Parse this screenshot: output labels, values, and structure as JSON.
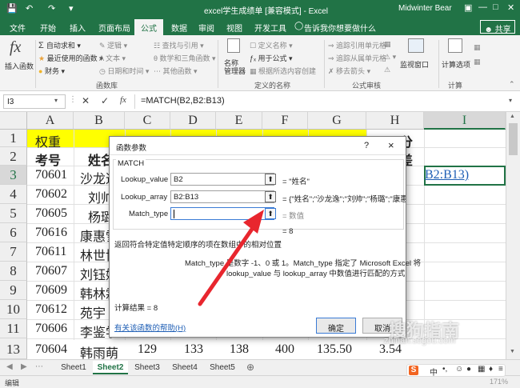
{
  "titlebar": {
    "title": "excel学生成绩单 [兼容模式] - Excel",
    "user": "Midwinter Bear"
  },
  "tabs": [
    "文件",
    "开始",
    "插入",
    "页面布局",
    "公式",
    "数据",
    "审阅",
    "视图",
    "开发工具"
  ],
  "tell_me": "告诉我你想要做什么",
  "share": "共享",
  "ribbon": {
    "insert_function": "插入函数",
    "autosum": "自动求和",
    "recent": "最近使用的函数",
    "finance": "财务",
    "logical": "逻辑",
    "text": "文本",
    "datetime": "日期和时间",
    "lookup": "查找与引用",
    "math": "数学和三角函数",
    "other": "其他函数",
    "group_library": "函数库",
    "name_manager": "名称\n管理器",
    "define_name": "定义名称",
    "use_in_formula": "用于公式",
    "create_from_sel": "根据所选内容创建",
    "group_names": "定义的名称",
    "trace_prec": "追踪引用单元格",
    "trace_dep": "追踪从属单元格",
    "remove_arrows": "移去箭头",
    "group_audit": "公式审核",
    "watch": "监视窗口",
    "calc_options": "计算选项",
    "group_calc": "计算"
  },
  "formula_bar": {
    "name_box": "I3",
    "formula": "=MATCH(B2,B2:B13)"
  },
  "columns": [
    "A",
    "B",
    "C",
    "D",
    "E",
    "F",
    "G",
    "H",
    "I"
  ],
  "rows": [
    "1",
    "2",
    "3",
    "4",
    "5",
    "6",
    "7",
    "8",
    "9",
    "10",
    "11",
    "12",
    "13"
  ],
  "cells": {
    "A1": "权重",
    "A2": "考号",
    "B2": "姓名",
    "H1": "分",
    "H2": "差",
    "I3": "B2:B13)",
    "A3": "70601",
    "B3": "沙龙逸",
    "A4": "70602",
    "B4": "刘帅",
    "A5": "70605",
    "B5": "杨璐",
    "A6": "70616",
    "B6": "康惠雪",
    "A7": "70611",
    "B7": "林世博",
    "A8": "70607",
    "B8": "刘钰婷",
    "A9": "70609",
    "B9": "韩林霖",
    "A10": "70612",
    "B10": "苑宇",
    "A11": "70606",
    "B11": "李鉴学",
    "A12": "70603",
    "B12": "王雪",
    "A13": "70604",
    "B13": "韩雨萌",
    "C13": "129",
    "D13": "133",
    "E13": "138",
    "F13": "400",
    "G13": "135.50",
    "H13": "3.54"
  },
  "dialog": {
    "title": "函数参数",
    "help_q": "?",
    "close": "×",
    "func_name": "MATCH",
    "args": [
      {
        "label": "Lookup_value",
        "value": "B2",
        "result": "= \"姓名\""
      },
      {
        "label": "Lookup_array",
        "value": "B2:B13",
        "result": "= {\"姓名\";\"沙龙逸\";\"刘帅\";\"杨璐\";\"康惠"
      },
      {
        "label": "Match_type",
        "value": "",
        "result": "= 数值"
      }
    ],
    "result_eq": "= 8",
    "desc": "返回符合特定值特定顺序的项在数组中的相对位置",
    "arg_desc_1": "Match_type  是数字 -1、0 或 1。Match_type 指定了 Microsoft Excel 将",
    "arg_desc_2": "lookup_value 与 lookup_array 中数值进行匹配的方式",
    "calc_result": "计算结果 =   8",
    "help_link": "有关该函数的帮助(H)",
    "ok": "确定",
    "cancel": "取消"
  },
  "sheets": [
    "Sheet1",
    "Sheet2",
    "Sheet3",
    "Sheet4",
    "Sheet5"
  ],
  "active_sheet": "Sheet2",
  "status": {
    "mode": "编辑",
    "zoom": "171%"
  },
  "watermark": "搜狗指南",
  "watermark_url": "zhinan.sogou.com",
  "colors": {
    "excel_green": "#217346",
    "header_yellow": "#ffff00",
    "arrow_red": "#e8262e"
  }
}
